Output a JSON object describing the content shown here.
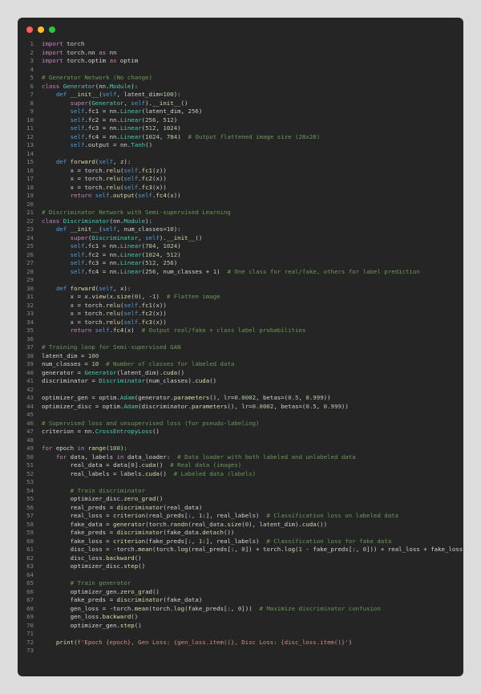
{
  "window": {
    "controls": [
      "close-dot",
      "minimize-dot",
      "maximize-dot"
    ],
    "colors": {
      "close": "#ff5f56",
      "minimize": "#ffbd2e",
      "maximize": "#27c93f",
      "background": "#252526"
    }
  },
  "code_lines": [
    "import torch",
    "import torch.nn as nn",
    "import torch.optim as optim",
    "",
    "# Generator Network (No change)",
    "class Generator(nn.Module):",
    "    def __init__(self, latent_dim=100):",
    "        super(Generator, self).__init__()",
    "        self.fc1 = nn.Linear(latent_dim, 256)",
    "        self.fc2 = nn.Linear(256, 512)",
    "        self.fc3 = nn.Linear(512, 1024)",
    "        self.fc4 = nn.Linear(1024, 784)  # Output flattened image size (28x28)",
    "        self.output = nn.Tanh()",
    "",
    "    def forward(self, z):",
    "        x = torch.relu(self.fc1(z))",
    "        x = torch.relu(self.fc2(x))",
    "        x = torch.relu(self.fc3(x))",
    "        return self.output(self.fc4(x))",
    "",
    "# Discriminator Network with Semi-supervised Learning",
    "class Discriminator(nn.Module):",
    "    def __init__(self, num_classes=10):",
    "        super(Discriminator, self).__init__()",
    "        self.fc1 = nn.Linear(784, 1024)",
    "        self.fc2 = nn.Linear(1024, 512)",
    "        self.fc3 = nn.Linear(512, 256)",
    "        self.fc4 = nn.Linear(256, num_classes + 1)  # One class for real/fake, others for label prediction",
    "",
    "    def forward(self, x):",
    "        x = x.view(x.size(0), -1)  # Flatten image",
    "        x = torch.relu(self.fc1(x))",
    "        x = torch.relu(self.fc2(x))",
    "        x = torch.relu(self.fc3(x))",
    "        return self.fc4(x)  # Output real/fake + class label probabilities",
    "",
    "# Training loop for Semi-supervised GAN",
    "latent_dim = 100",
    "num_classes = 10  # Number of classes for labeled data",
    "generator = Generator(latent_dim).cuda()",
    "discriminator = Discriminator(num_classes).cuda()",
    "",
    "optimizer_gen = optim.Adam(generator.parameters(), lr=0.0002, betas=(0.5, 0.999))",
    "optimizer_disc = optim.Adam(discriminator.parameters(), lr=0.0002, betas=(0.5, 0.999))",
    "",
    "# Supervised loss and unsupervised loss (for pseudo-labeling)",
    "criterion = nn.CrossEntropyLoss()",
    "",
    "for epoch in range(100):",
    "    for data, labels in data_loader:  # Data loader with both labeled and unlabeled data",
    "        real_data = data[0].cuda()  # Real data (images)",
    "        real_labels = labels.cuda()  # Labeled data (labels)",
    "",
    "        # Train discriminator",
    "        optimizer_disc.zero_grad()",
    "        real_preds = discriminator(real_data)",
    "        real_loss = criterion(real_preds[:, 1:], real_labels)  # Classification loss on labeled data",
    "        fake_data = generator(torch.randn(real_data.size(0), latent_dim).cuda())",
    "        fake_preds = discriminator(fake_data.detach())",
    "        fake_loss = criterion(fake_preds[:, 1:], real_labels)  # Classification loss for fake data",
    "        disc_loss = -torch.mean(torch.log(real_preds[:, 0]) + torch.log(1 - fake_preds[:, 0])) + real_loss + fake_loss",
    "        disc_loss.backward()",
    "        optimizer_disc.step()",
    "",
    "        # Train generator",
    "        optimizer_gen.zero_grad()",
    "        fake_preds = discriminator(fake_data)",
    "        gen_loss = -torch.mean(torch.log(fake_preds[:, 0]))  # Maximize discriminator confusion",
    "        gen_loss.backward()",
    "        optimizer_gen.step()",
    "",
    "    print(f'Epoch {epoch}, Gen Loss: {gen_loss.item()}, Disc Loss: {disc_loss.item()}')",
    ""
  ]
}
